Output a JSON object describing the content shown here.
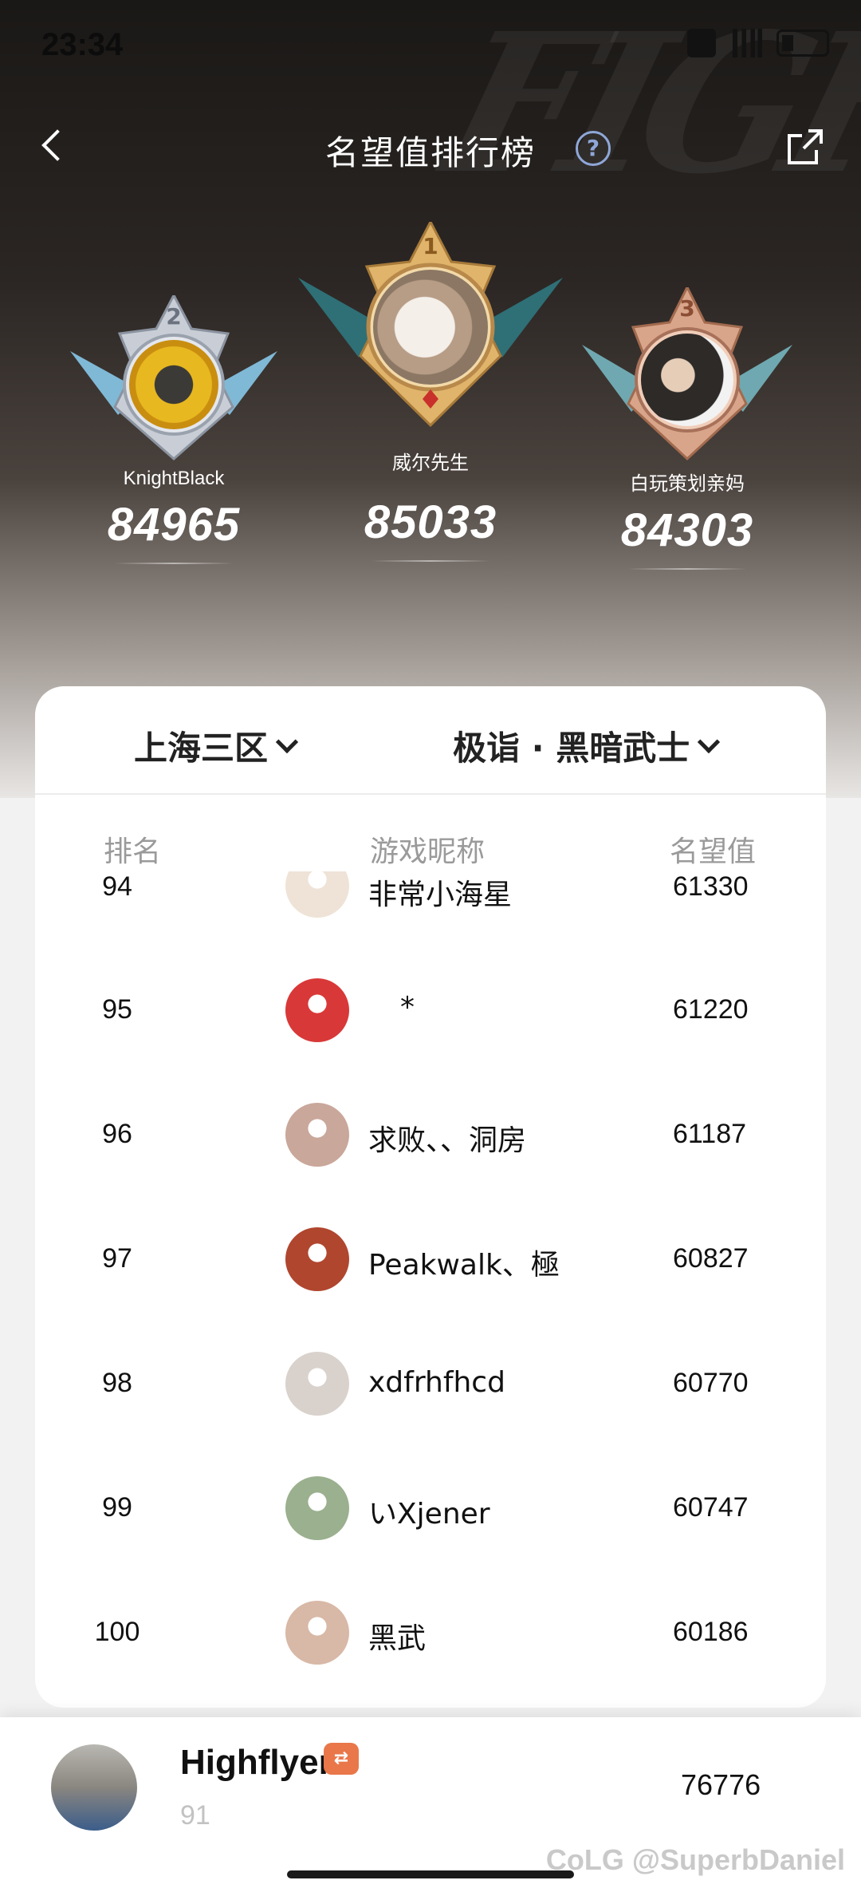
{
  "status": {
    "time": "23:34"
  },
  "nav": {
    "title": "名望值排行榜",
    "help": "?"
  },
  "hero_decoration": "FIGHT",
  "podium": [
    {
      "rank": "2",
      "name": "KnightBlack",
      "score": "84965",
      "avatar": "husky-sunflower-avatar"
    },
    {
      "rank": "1",
      "name": "威尔先生",
      "score": "85033",
      "avatar": "cat-avatar"
    },
    {
      "rank": "3",
      "name": "白玩策划亲妈",
      "score": "84303",
      "avatar": "man-avatar"
    }
  ],
  "filters": {
    "region": "上海三区",
    "class": "极诣 · 黑暗武士"
  },
  "columns": {
    "rank": "排名",
    "name": "游戏昵称",
    "score": "名望值"
  },
  "rows": [
    {
      "rank": "94",
      "name": "非常小海星",
      "score": "61330",
      "avatar_color": "#efe3d8"
    },
    {
      "rank": "95",
      "name": "*",
      "score": "61220",
      "avatar_color": "#d93838"
    },
    {
      "rank": "96",
      "name": "求败、、洞房",
      "score": "61187",
      "avatar_color": "#c9a79a"
    },
    {
      "rank": "97",
      "name": "Peakwalk、極",
      "score": "60827",
      "avatar_color": "#b0462e"
    },
    {
      "rank": "98",
      "name": "xdfrhfhcd",
      "score": "60770",
      "avatar_color": "#d9d2cc"
    },
    {
      "rank": "99",
      "name": "いXjener",
      "score": "60747",
      "avatar_color": "#9ab08e"
    },
    {
      "rank": "100",
      "name": "黑武",
      "score": "60186",
      "avatar_color": "#d8b8a6"
    }
  ],
  "me": {
    "name": "Highflyer",
    "badge": "⇄",
    "rank": "91",
    "score": "76776"
  },
  "watermark": "CoLG @SuperbDaniel"
}
